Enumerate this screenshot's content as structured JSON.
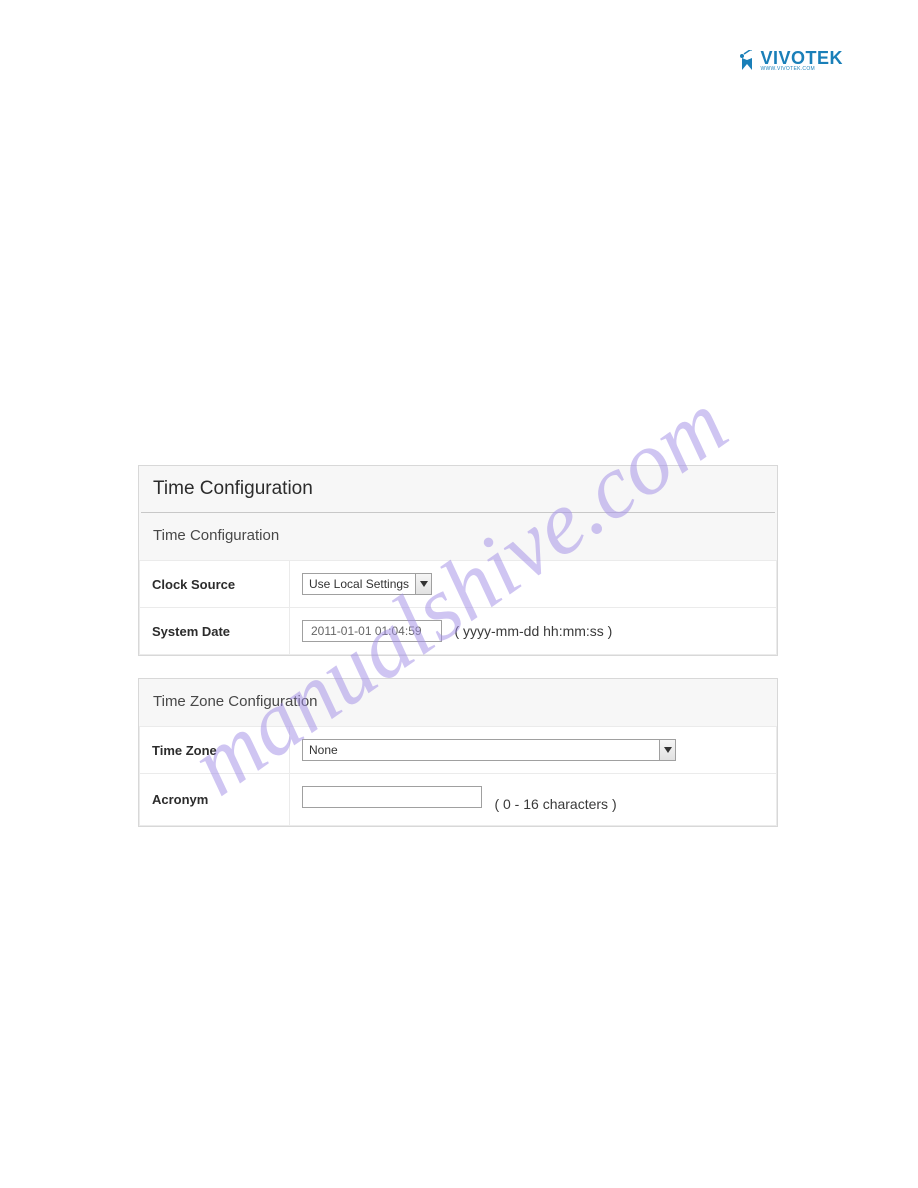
{
  "logo": {
    "text": "VIVOTEK",
    "subtext": "WWW.VIVOTEK.COM"
  },
  "watermark": "manualshive.com",
  "timeConfig": {
    "pageTitle": "Time Configuration",
    "sectionTitle": "Time Configuration",
    "clockSource": {
      "label": "Clock Source",
      "value": "Use Local Settings"
    },
    "systemDate": {
      "label": "System Date",
      "value": "2011-01-01 01:04:59",
      "hint": "( yyyy-mm-dd hh:mm:ss )"
    }
  },
  "timeZoneConfig": {
    "sectionTitle": "Time Zone Configuration",
    "timeZone": {
      "label": "Time Zone",
      "value": "None"
    },
    "acronym": {
      "label": "Acronym",
      "value": "",
      "hint": "( 0 - 16 characters )"
    }
  }
}
